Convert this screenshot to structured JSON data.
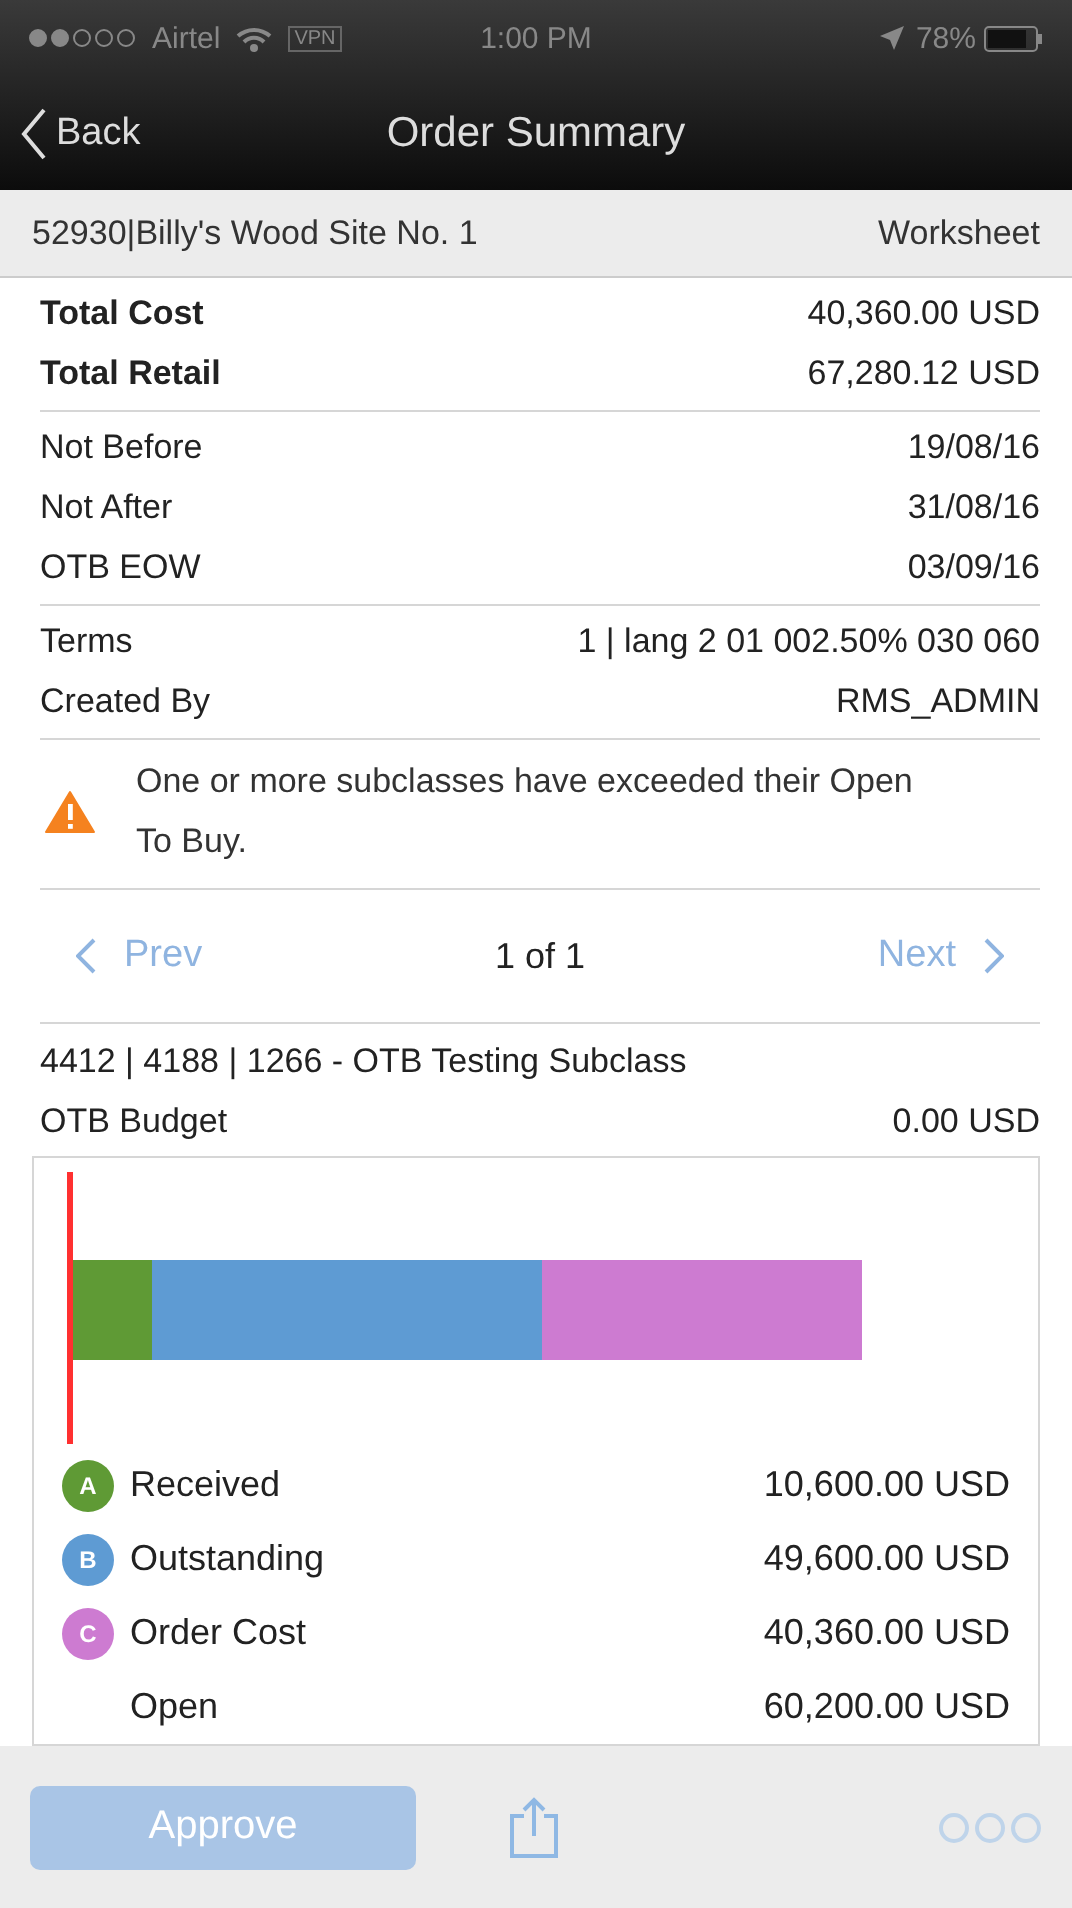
{
  "status_bar": {
    "carrier": "Airtel",
    "vpn": "VPN",
    "time": "1:00 PM",
    "battery": "78%"
  },
  "nav": {
    "back": "Back",
    "title": "Order Summary"
  },
  "header": {
    "order": "52930|Billy's Wood Site No. 1",
    "status": "Worksheet"
  },
  "groups": [
    {
      "rows": [
        {
          "label": "Total Cost",
          "value": "40,360.00 USD",
          "bold": true
        },
        {
          "label": "Total Retail",
          "value": "67,280.12 USD",
          "bold": true
        }
      ]
    },
    {
      "rows": [
        {
          "label": "Not Before",
          "value": "19/08/16",
          "bold": false
        },
        {
          "label": "Not After",
          "value": "31/08/16",
          "bold": false
        },
        {
          "label": "OTB EOW",
          "value": "03/09/16",
          "bold": false
        }
      ]
    },
    {
      "rows": [
        {
          "label": "Terms",
          "value": "1 | lang 2 01 002.50% 030 060",
          "bold": false
        },
        {
          "label": "Created By",
          "value": "RMS_ADMIN",
          "bold": false
        }
      ]
    }
  ],
  "warning": "One or more subclasses have exceeded their Open To Buy.",
  "pager": {
    "prev": "Prev",
    "position": "1 of 1",
    "next": "Next",
    "prev_disabled": true,
    "next_disabled": true
  },
  "subclass": {
    "title": "4412 | 4188 | 1266 - OTB Testing Subclass",
    "budget_label": "OTB Budget",
    "budget_value": "0.00 USD"
  },
  "legend": [
    {
      "letter": "A",
      "label": "Received",
      "value": "10,600.00 USD",
      "color": "#5f9a35"
    },
    {
      "letter": "B",
      "label": "Outstanding",
      "value": "49,600.00 USD",
      "color": "#5e9bd3"
    },
    {
      "letter": "C",
      "label": "Order Cost",
      "value": "40,360.00 USD",
      "color": "#cd7bd1"
    },
    {
      "label": "Open",
      "value": "60,200.00 USD"
    }
  ],
  "toolbar": {
    "approve": "Approve",
    "approve_disabled": true
  }
}
